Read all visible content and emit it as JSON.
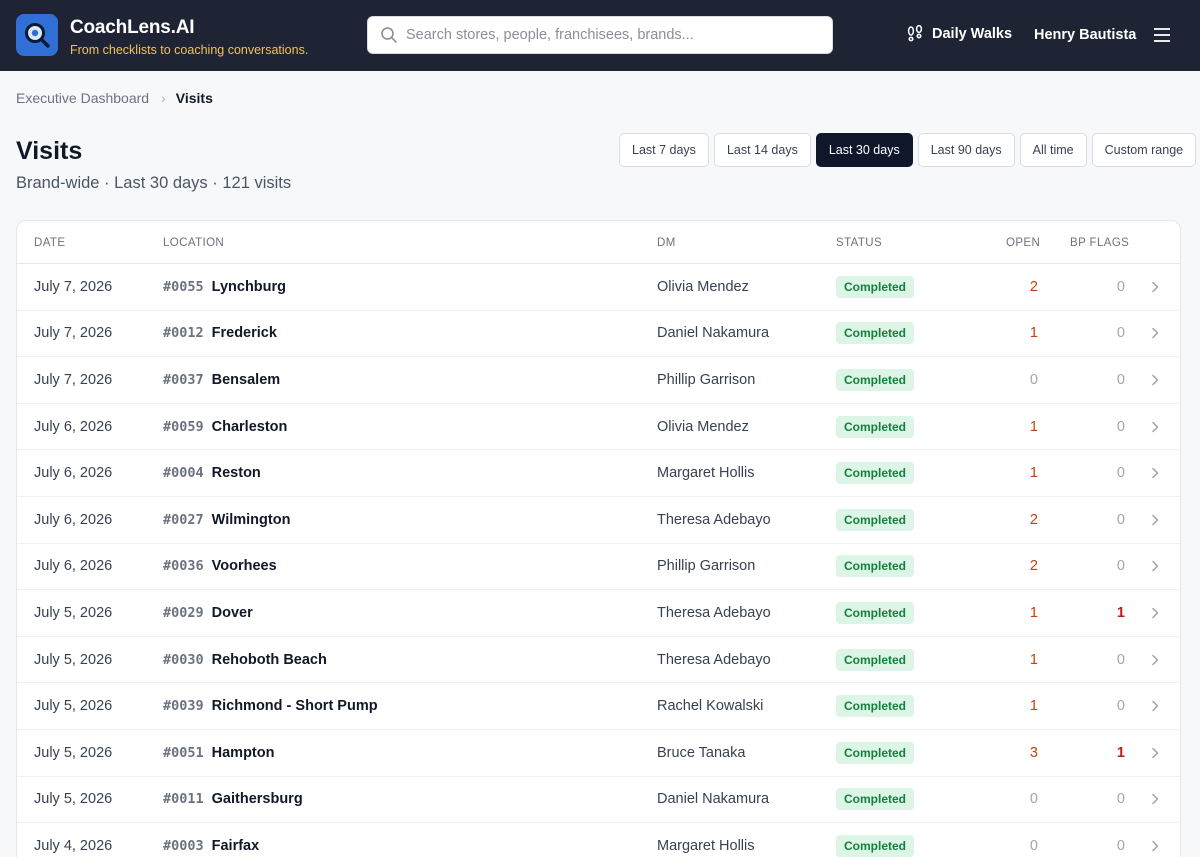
{
  "header": {
    "brand_name": "CoachLens.AI",
    "tagline": "From checklists to coaching conversations.",
    "search_placeholder": "Search stores, people, franchisees, brands...",
    "daily_walks": "Daily Walks",
    "user_name": "Henry Bautista",
    "icons": [
      "magnifier-logo-icon",
      "search-icon",
      "footprints-icon",
      "hamburger-menu-icon"
    ]
  },
  "breadcrumb": {
    "parent": "Executive Dashboard",
    "current": "Visits"
  },
  "page": {
    "title": "Visits",
    "subtitle": "Brand-wide · Last 30 days · 121 visits"
  },
  "ranges": [
    {
      "label": "Last 7 days",
      "active": false
    },
    {
      "label": "Last 14 days",
      "active": false
    },
    {
      "label": "Last 30 days",
      "active": true
    },
    {
      "label": "Last 90 days",
      "active": false
    },
    {
      "label": "All time",
      "active": false
    },
    {
      "label": "Custom range",
      "active": false
    }
  ],
  "table": {
    "columns": {
      "date": "DATE",
      "location": "LOCATION",
      "dm": "DM",
      "status": "STATUS",
      "open": "OPEN",
      "bp_flags": "BP FLAGS"
    },
    "rows": [
      {
        "date": "July 7, 2026",
        "store": "#0055",
        "city": "Lynchburg",
        "dm": "Olivia Mendez",
        "status": "Completed",
        "open": 2,
        "bp": 0
      },
      {
        "date": "July 7, 2026",
        "store": "#0012",
        "city": "Frederick",
        "dm": "Daniel Nakamura",
        "status": "Completed",
        "open": 1,
        "bp": 0
      },
      {
        "date": "July 7, 2026",
        "store": "#0037",
        "city": "Bensalem",
        "dm": "Phillip Garrison",
        "status": "Completed",
        "open": 0,
        "bp": 0
      },
      {
        "date": "July 6, 2026",
        "store": "#0059",
        "city": "Charleston",
        "dm": "Olivia Mendez",
        "status": "Completed",
        "open": 1,
        "bp": 0
      },
      {
        "date": "July 6, 2026",
        "store": "#0004",
        "city": "Reston",
        "dm": "Margaret Hollis",
        "status": "Completed",
        "open": 1,
        "bp": 0
      },
      {
        "date": "July 6, 2026",
        "store": "#0027",
        "city": "Wilmington",
        "dm": "Theresa Adebayo",
        "status": "Completed",
        "open": 2,
        "bp": 0
      },
      {
        "date": "July 6, 2026",
        "store": "#0036",
        "city": "Voorhees",
        "dm": "Phillip Garrison",
        "status": "Completed",
        "open": 2,
        "bp": 0
      },
      {
        "date": "July 5, 2026",
        "store": "#0029",
        "city": "Dover",
        "dm": "Theresa Adebayo",
        "status": "Completed",
        "open": 1,
        "bp": 1
      },
      {
        "date": "July 5, 2026",
        "store": "#0030",
        "city": "Rehoboth Beach",
        "dm": "Theresa Adebayo",
        "status": "Completed",
        "open": 1,
        "bp": 0
      },
      {
        "date": "July 5, 2026",
        "store": "#0039",
        "city": "Richmond - Short Pump",
        "dm": "Rachel Kowalski",
        "status": "Completed",
        "open": 1,
        "bp": 0
      },
      {
        "date": "July 5, 2026",
        "store": "#0051",
        "city": "Hampton",
        "dm": "Bruce Tanaka",
        "status": "Completed",
        "open": 3,
        "bp": 1
      },
      {
        "date": "July 5, 2026",
        "store": "#0011",
        "city": "Gaithersburg",
        "dm": "Daniel Nakamura",
        "status": "Completed",
        "open": 0,
        "bp": 0
      },
      {
        "date": "July 4, 2026",
        "store": "#0003",
        "city": "Fairfax",
        "dm": "Margaret Hollis",
        "status": "Completed",
        "open": 0,
        "bp": 0
      }
    ]
  },
  "colors": {
    "header_bg": "#1e2433",
    "tagline": "#f2c25c",
    "active_range": "#0f172a",
    "status_bg": "#dcf5e6",
    "status_text": "#15803d",
    "open_nonzero": "#c2410c",
    "bp_nonzero": "#b91c1c"
  }
}
